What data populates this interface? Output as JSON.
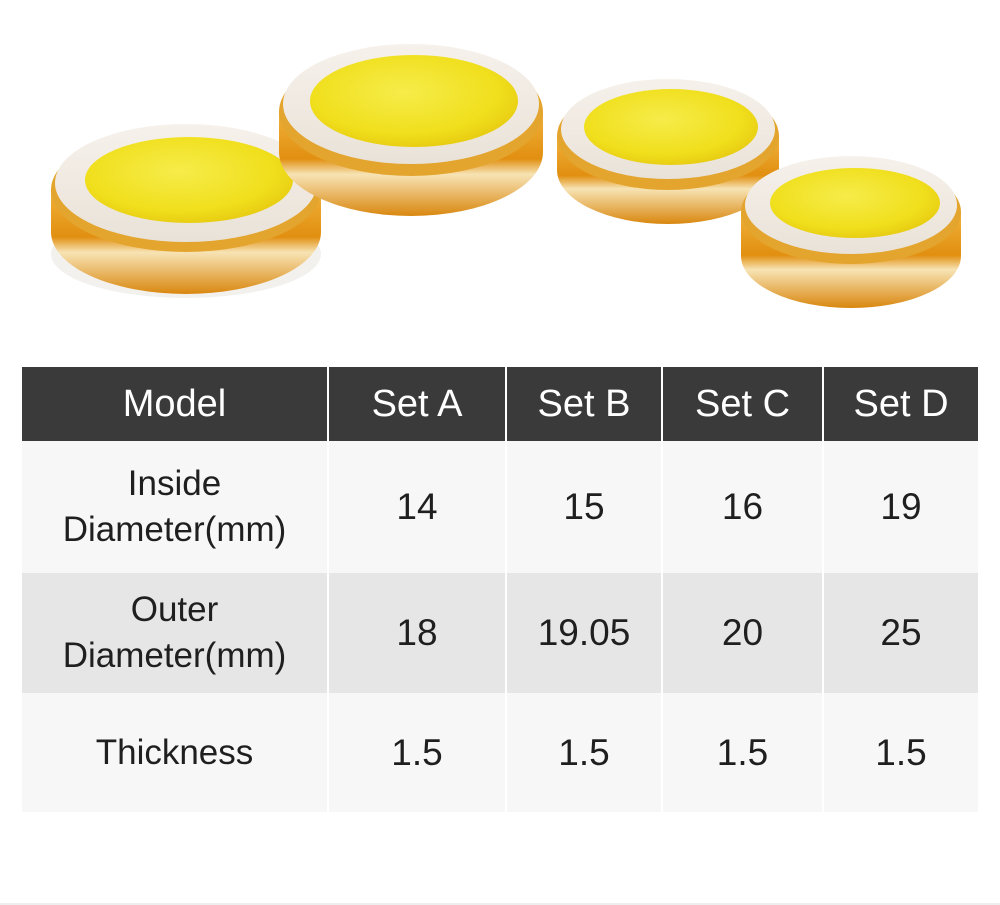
{
  "colors": {
    "header_bg": "#3a3a3a",
    "row_light": "#f7f7f7",
    "row_dark": "#e6e6e6",
    "lens_yellow": "#f3e321",
    "ring_white": "#f1ece6",
    "edge_amber": "#e7a21d"
  },
  "table": {
    "columns": [
      "Model",
      "Set A",
      "Set B",
      "Set C",
      "Set D"
    ],
    "rows": [
      {
        "label_line1": "Inside",
        "label_line2": "Diameter(mm)",
        "values": [
          "14",
          "15",
          "16",
          "19"
        ]
      },
      {
        "label_line1": "Outer",
        "label_line2": "Diameter(mm)",
        "values": [
          "18",
          "19.05",
          "20",
          "25"
        ]
      },
      {
        "label_line1": "Thickness",
        "label_line2": "",
        "values": [
          "1.5",
          "1.5",
          "1.5",
          "1.5"
        ]
      }
    ]
  }
}
